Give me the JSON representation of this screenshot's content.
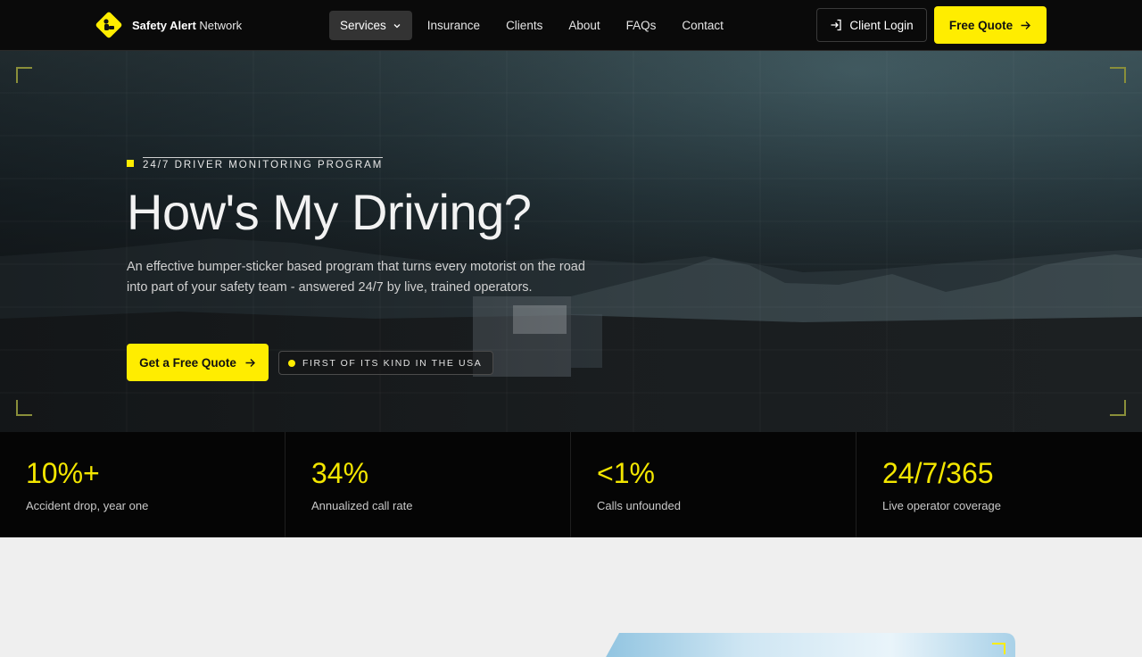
{
  "brand": {
    "name_bold": "Safety Alert",
    "name_light": "Network",
    "logo_icon": "warning-diamond-icon"
  },
  "nav": {
    "items": [
      {
        "label": "Services",
        "active": true,
        "has_dropdown": true
      },
      {
        "label": "Insurance"
      },
      {
        "label": "Clients"
      },
      {
        "label": "About"
      },
      {
        "label": "FAQs"
      },
      {
        "label": "Contact"
      }
    ],
    "login_label": "Client Login",
    "quote_label": "Free Quote"
  },
  "hero": {
    "eyebrow": "24/7 DRIVER MONITORING PROGRAM",
    "title": "How's My Driving?",
    "description": "An effective bumper-sticker based program that turns every motorist on the road into part of your safety team - answered 24/7 by live, trained operators.",
    "cta_label": "Get a Free Quote",
    "badge": "FIRST OF ITS KIND IN THE USA"
  },
  "stats": [
    {
      "value": "10%+",
      "label": "Accident drop, year one"
    },
    {
      "value": "34%",
      "label": "Annualized call rate"
    },
    {
      "value": "<1%",
      "label": "Calls unfounded"
    },
    {
      "value": "24/7/365",
      "label": "Live operator coverage"
    }
  ],
  "colors": {
    "accent": "#ffed00",
    "nav_bg": "#0a0a0a",
    "stats_bg": "#050505",
    "page_bg": "#efefef"
  }
}
